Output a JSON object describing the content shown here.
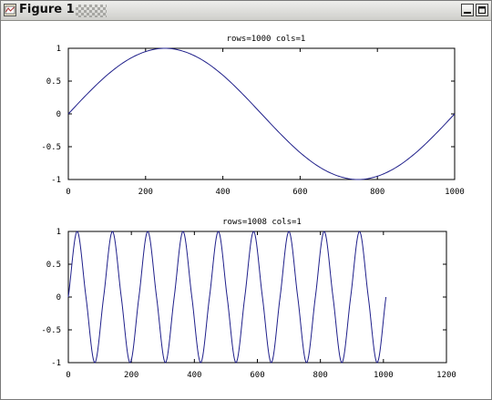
{
  "window": {
    "title": "Figure 1",
    "buttons": [
      "minimize",
      "maximize"
    ],
    "icons": [
      "figure-icon",
      "minimize-icon",
      "maximize-icon"
    ]
  },
  "colors": {
    "line": "#1f1f8a",
    "axes": "#000000",
    "titlebar": "#dcdcd8"
  },
  "chart_data": [
    {
      "type": "line",
      "title": "rows=1000 cols=1",
      "xlim": [
        0,
        1000
      ],
      "ylim": [
        -1,
        1
      ],
      "xticks": [
        0,
        200,
        400,
        600,
        800,
        1000
      ],
      "yticks": [
        1,
        0.5,
        0,
        -0.5,
        -1
      ],
      "xlabel": "",
      "ylabel": "",
      "grid": false,
      "series": [
        {
          "n_points": 1000,
          "x": [
            0,
            50,
            100,
            150,
            200,
            250,
            300,
            350,
            400,
            450,
            500,
            550,
            600,
            650,
            700,
            750,
            800,
            850,
            900,
            950,
            1000
          ],
          "y": [
            0,
            0.31,
            0.59,
            0.81,
            0.95,
            1,
            0.95,
            0.81,
            0.59,
            0.31,
            0,
            -0.31,
            -0.59,
            -0.81,
            -0.95,
            -1,
            -0.95,
            -0.81,
            -0.59,
            -0.31,
            0
          ]
        }
      ]
    },
    {
      "type": "line",
      "title": "rows=1008 cols=1",
      "xlim": [
        0,
        1200
      ],
      "ylim": [
        -1,
        1
      ],
      "xticks": [
        0,
        200,
        400,
        600,
        800,
        1000,
        1200
      ],
      "yticks": [
        1,
        0.5,
        0,
        -0.5,
        -1
      ],
      "xlabel": "",
      "ylabel": "",
      "grid": false,
      "series": [
        {
          "n_points": 1008,
          "x": [
            0,
            28,
            56,
            84,
            112,
            140,
            168,
            196,
            224,
            252,
            280,
            308,
            336,
            364,
            392,
            420,
            448,
            476,
            504,
            532,
            560,
            588,
            616,
            644,
            672,
            700,
            728,
            756,
            784,
            812,
            840,
            868,
            896,
            924,
            952,
            980,
            1008
          ],
          "y": [
            0,
            1,
            0,
            -1,
            0,
            1,
            0,
            -1,
            0,
            1,
            0,
            -1,
            0,
            1,
            0,
            -1,
            0,
            1,
            0,
            -1,
            0,
            1,
            0,
            -1,
            0,
            1,
            0,
            -1,
            0,
            1,
            0,
            -1,
            0,
            1,
            0,
            -1,
            0
          ]
        }
      ]
    }
  ]
}
